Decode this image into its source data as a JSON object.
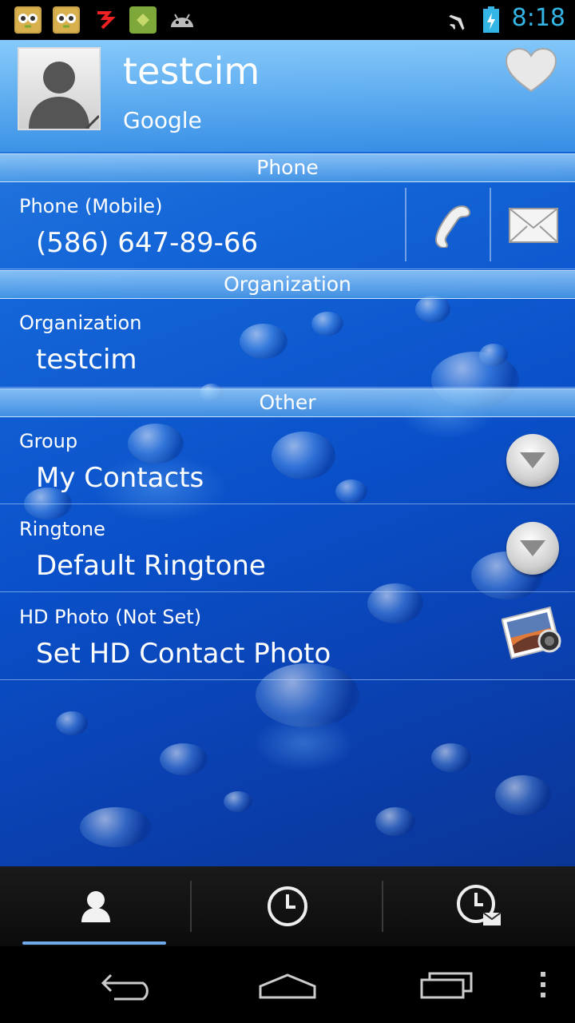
{
  "status_bar": {
    "time": "8:18",
    "notification_icons": [
      "owl-app-icon",
      "owl-app-icon",
      "red-app-icon",
      "green-app-icon",
      "android-debug-icon"
    ],
    "system_icons": [
      "airplane-mode-icon",
      "battery-charging-icon"
    ],
    "accent_color": "#33b5e5"
  },
  "contact": {
    "name": "testcim",
    "account": "Google",
    "favorite_icon": "heart-icon"
  },
  "sections": {
    "phone": "Phone",
    "organization": "Organization",
    "other": "Other"
  },
  "phone_row": {
    "label": "Phone  (Mobile)",
    "value": "(586) 647-89-66",
    "call_icon": "phone-handset-icon",
    "message_icon": "envelope-icon"
  },
  "organization_row": {
    "label": "Organization",
    "value": "testcim"
  },
  "group_row": {
    "label": "Group",
    "value": "My Contacts"
  },
  "ringtone_row": {
    "label": "Ringtone",
    "value": "Default Ringtone"
  },
  "hd_photo_row": {
    "label": "HD Photo (Not Set)",
    "value": "Set HD Contact Photo",
    "icon": "photo-camera-icon"
  },
  "tabs": [
    {
      "icon": "contact-person-icon",
      "selected": true
    },
    {
      "icon": "clock-icon",
      "selected": false
    },
    {
      "icon": "clock-message-icon",
      "selected": false
    }
  ],
  "navigation": [
    "back-icon",
    "home-icon",
    "recent-apps-icon",
    "overflow-menu-icon"
  ],
  "colors": {
    "wallpaper": "#1466d8",
    "tab_indicator": "#6fa9ea"
  }
}
